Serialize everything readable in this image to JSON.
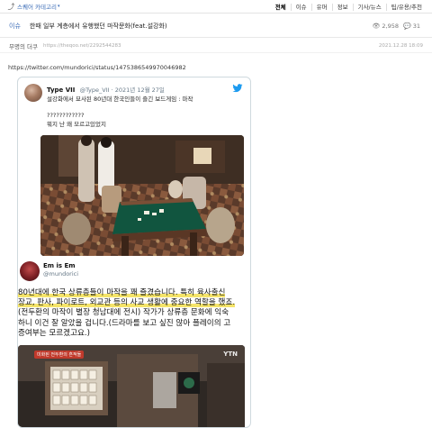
{
  "nav": {
    "share_category": "스퀘어 카테고리",
    "items": [
      "전체",
      "이슈",
      "유머",
      "정보",
      "기사/뉴스",
      "팁/유용/추천"
    ]
  },
  "post": {
    "category": "이슈",
    "title": "한때 일부 계층에서 유행했던 마작문화(feat.설강화)",
    "views": "2,958",
    "comments": "31",
    "author": "무명의 더쿠",
    "source_url": "https://theqoo.net/2292544283",
    "date": "2021.12.28 18:09",
    "body_link": "https://twitter.com/mundorici/status/1475386549970046982"
  },
  "tweet1": {
    "name": "Type VII",
    "handle": "@Type_VII · 2021년 12월 27일",
    "line1": "설강화에서 묘사된 80년대 한국인들이 즐긴 보드게임 : 마작",
    "line2": "????????????",
    "line3": "뭐지 난 왜 모르고있었지"
  },
  "tweet2": {
    "name": "Em is Em",
    "handle": "@mundorici",
    "lines": [
      "80년대에 한국 상류층들이 마작을 꽤 즐겼습니다. 특히 육사출신",
      "장교, 판사, 파이로트, 외교관 등의 사교 생활에 중요한 역할을 했죠.",
      "(전두환의 마작이 별장 청남대에 전시) 작가가 상류층 문화에 익숙",
      "하니 이건 잘 알았을 겁니다.(드라마를 보고 싶진 않아 플레이의 고",
      "증여부는 모르겠고요.)"
    ],
    "image_tag": "미화된 전두환의 흔적들",
    "image_logo": "YTN"
  },
  "colors": {
    "link": "#3b6cb7",
    "twitter": "#1d9bf0",
    "highlight": "#f5e46a"
  }
}
